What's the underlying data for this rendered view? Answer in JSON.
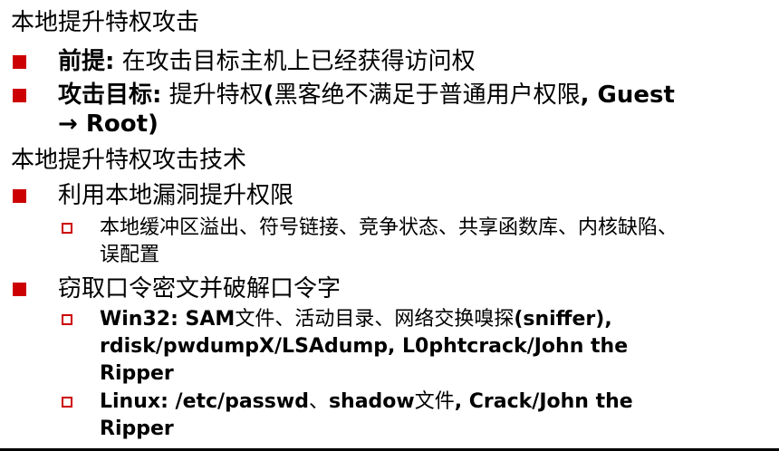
{
  "heading1": "本地提升特权攻击",
  "item1": {
    "label": "前提:",
    "text": " 在攻击目标主机上已经获得访问权"
  },
  "item2": {
    "label": "攻击目标:",
    "text_a": " 提升特权",
    "paren_open": "(",
    "text_b": "黑客绝不满足于普通用户权限",
    "bold_tail": ", Guest",
    "line2": "→ Root)"
  },
  "heading2": "本地提升特权攻击技术",
  "item3": {
    "text": "利用本地漏洞提升权限"
  },
  "sub1": {
    "line1": "本地缓冲区溢出、符号链接、竞争状态、共享函数库、内核缺陷、",
    "line2": "误配置"
  },
  "item4": {
    "text": "窃取口令密文并破解口令字"
  },
  "sub2": {
    "label": "Win32: SAM",
    "text_a": "文件、活动目录、网络交换嗅探",
    "bold_a": "(sniffer),",
    "line2": "rdisk/pwdumpX/LSAdump,  L0phtcrack/John the",
    "line3": "Ripper"
  },
  "sub3": {
    "label": "Linux: /etc/passwd",
    "sep": "、",
    "bold_b": "shadow",
    "text_b": "文件",
    "bold_c": ", Crack/John the",
    "line2": "Ripper"
  },
  "colors": {
    "bullet": "#cc0000",
    "text": "#000000",
    "rule": "#000000"
  }
}
